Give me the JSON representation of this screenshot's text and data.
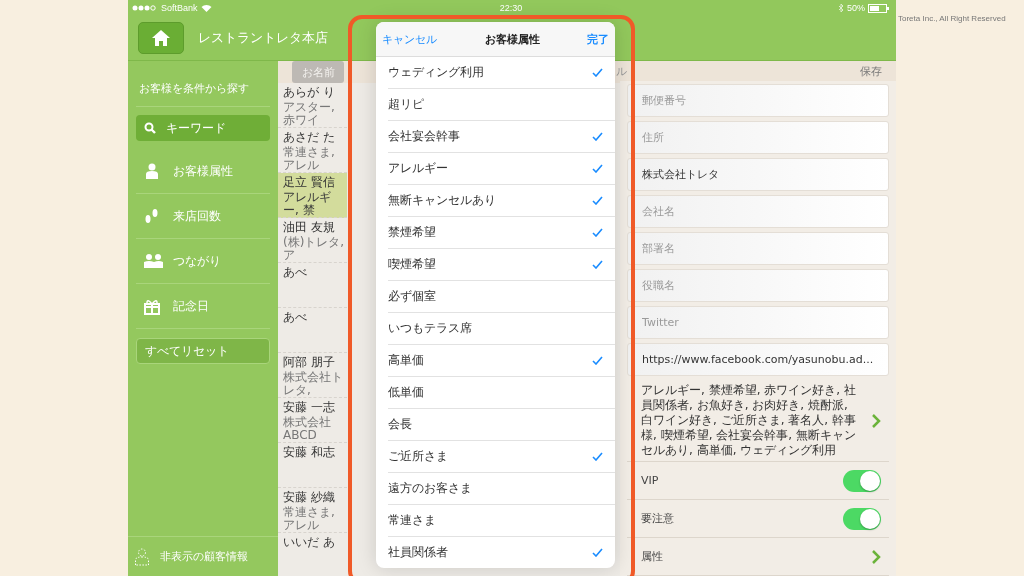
{
  "credit": "Toreta Inc., All Right Reserved",
  "status_bar": {
    "carrier": "SoftBank",
    "time": "22:30",
    "battery": "50%"
  },
  "header": {
    "title": "レストラントレタ本店"
  },
  "sidebar": {
    "heading": "お客様を条件から探す",
    "items": [
      {
        "label": "キーワード",
        "kind": "search",
        "selected": true
      },
      {
        "label": "お客様属性",
        "kind": "person",
        "selected": false
      },
      {
        "label": "来店回数",
        "kind": "footprints",
        "selected": false
      },
      {
        "label": "つながり",
        "kind": "people",
        "selected": false
      },
      {
        "label": "記念日",
        "kind": "gift",
        "selected": false
      }
    ],
    "reset_button": "すべてリセット",
    "hidden_link": "非表示の顧客情報"
  },
  "customer_list": {
    "sort_button": "お名前",
    "rows": [
      {
        "name": "あらが り",
        "note": "アスター, 赤ワイ",
        "selected": false
      },
      {
        "name": "あさだ た",
        "note": "常連さま, アレル",
        "selected": false
      },
      {
        "name": "足立 賢信",
        "note": "アレルギー, 禁",
        "selected": true
      },
      {
        "name": "油田 友規",
        "note": "(株)トレタ, ア",
        "selected": false
      },
      {
        "name": "あべ",
        "selected": false
      },
      {
        "name": "あべ",
        "selected": false
      },
      {
        "name": "阿部 朋子",
        "note": "株式会社トレタ,",
        "selected": false
      },
      {
        "name": "安藤 一志",
        "note": "株式会社ABCD",
        "selected": false
      },
      {
        "name": "安藤 和志",
        "selected": false
      },
      {
        "name": "安藤 紗織",
        "note": "常連さま, アレル",
        "selected": false
      },
      {
        "name": "いいだ あ",
        "selected": false
      }
    ]
  },
  "detail": {
    "cancel_fragment": "ル",
    "save_button": "保存",
    "fields": [
      {
        "placeholder": "郵便番号"
      },
      {
        "placeholder": "住所"
      },
      {
        "value": "株式会社トレタ"
      },
      {
        "placeholder": "会社名"
      },
      {
        "placeholder": "部署名"
      },
      {
        "placeholder": "役職名"
      },
      {
        "placeholder": "Twitter"
      },
      {
        "value": "https://www.facebook.com/yasunobu.ad..."
      }
    ],
    "attributes_text": "アレルギー, 禁煙希望, 赤ワイン好き, 社員関係者, お魚好き, お肉好き, 焼酎派, 白ワイン好き, ご近所さま, 著名人, 幹事様, 喫煙希望, 会社宴会幹事, 無断キャンセルあり, 高単価, ウェディング利用",
    "switches": [
      {
        "label": "VIP",
        "on": true
      },
      {
        "label": "要注意",
        "on": true
      }
    ],
    "next_row": "属性"
  },
  "popover": {
    "cancel": "キャンセル",
    "title": "お客様属性",
    "done": "完了",
    "items": [
      {
        "label": "ウェディング利用",
        "checked": true
      },
      {
        "label": "超リピ",
        "checked": false
      },
      {
        "label": "会社宴会幹事",
        "checked": true
      },
      {
        "label": "アレルギー",
        "checked": true
      },
      {
        "label": "無断キャンセルあり",
        "checked": true
      },
      {
        "label": "禁煙希望",
        "checked": true
      },
      {
        "label": "喫煙希望",
        "checked": true
      },
      {
        "label": "必ず個室",
        "checked": false
      },
      {
        "label": "いつもテラス席",
        "checked": false
      },
      {
        "label": "高単価",
        "checked": true
      },
      {
        "label": "低単価",
        "checked": false
      },
      {
        "label": "会長",
        "checked": false
      },
      {
        "label": "ご近所さま",
        "checked": true
      },
      {
        "label": "遠方のお客さま",
        "checked": false
      },
      {
        "label": "常連さま",
        "checked": false
      },
      {
        "label": "社員関係者",
        "checked": true
      }
    ]
  }
}
